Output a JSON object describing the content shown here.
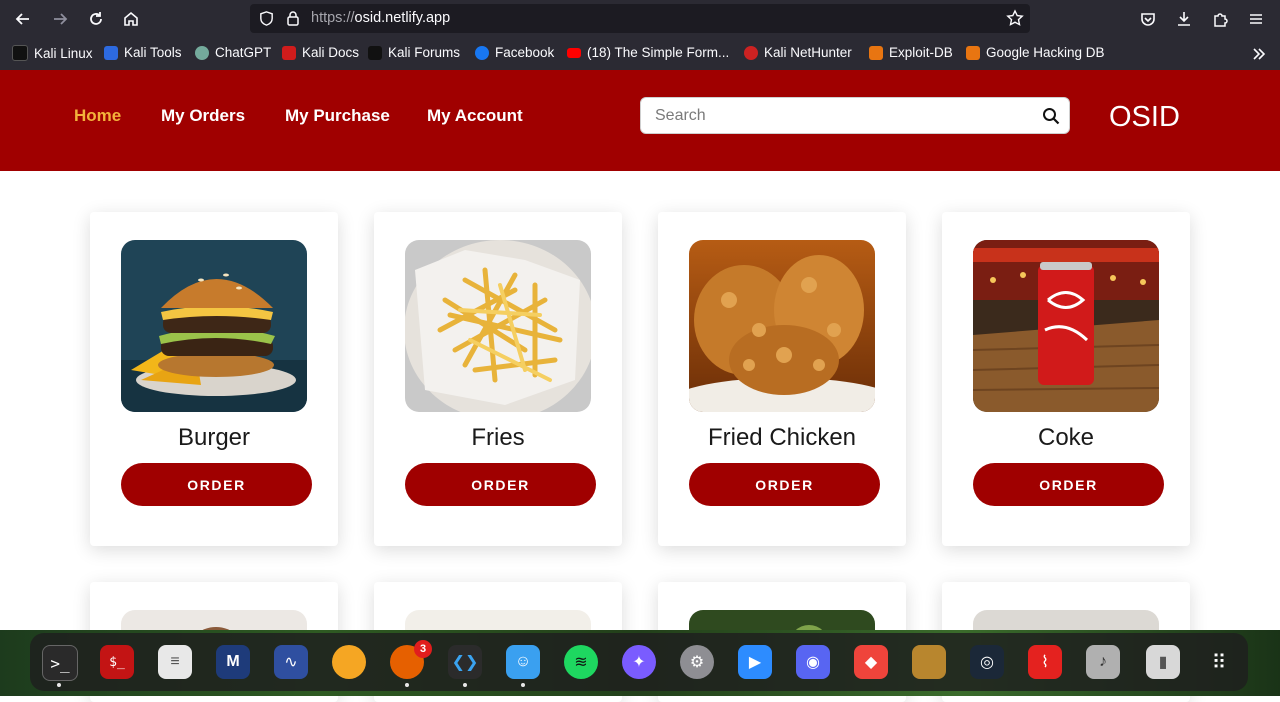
{
  "browser": {
    "url_scheme": "https://",
    "url_host": "osid.netlify.app"
  },
  "bookmarks": [
    {
      "label": "Kali Linux",
      "icon": "kali-dragon-icon"
    },
    {
      "label": "Kali Tools",
      "icon": "kali-tools-icon"
    },
    {
      "label": "ChatGPT",
      "icon": "chatgpt-icon"
    },
    {
      "label": "Kali Docs",
      "icon": "kali-docs-icon"
    },
    {
      "label": "Kali Forums",
      "icon": "kali-forums-icon"
    },
    {
      "label": "Facebook",
      "icon": "facebook-icon"
    },
    {
      "label": "(18) The Simple Form...",
      "icon": "youtube-icon"
    },
    {
      "label": "Kali NetHunter",
      "icon": "nethunter-icon"
    },
    {
      "label": "Exploit-DB",
      "icon": "exploit-db-icon"
    },
    {
      "label": "Google Hacking DB",
      "icon": "ghdb-icon"
    }
  ],
  "site": {
    "nav": [
      {
        "label": "Home",
        "active": true
      },
      {
        "label": "My Orders",
        "active": false
      },
      {
        "label": "My Purchase",
        "active": false
      },
      {
        "label": "My Account",
        "active": false
      }
    ],
    "search_placeholder": "Search",
    "brand": "OSID",
    "colors": {
      "primary": "#a00000",
      "active_nav": "#f3b23b"
    }
  },
  "products": [
    {
      "name": "Burger",
      "button": "ORDER"
    },
    {
      "name": "Fries",
      "button": "ORDER"
    },
    {
      "name": "Fried Chicken",
      "button": "ORDER"
    },
    {
      "name": "Coke",
      "button": "ORDER"
    }
  ],
  "dock": {
    "apps": [
      "terminal",
      "root-terminal",
      "text-editor",
      "metasploit",
      "wireshark",
      "orange",
      "firefox",
      "vscode",
      "finder",
      "spotify",
      "messenger",
      "settings",
      "zoom",
      "discord",
      "anydesk",
      "stardew",
      "steam",
      "acrobat",
      "volume",
      "trash",
      "app-grid"
    ],
    "firefox_badge": "3"
  }
}
